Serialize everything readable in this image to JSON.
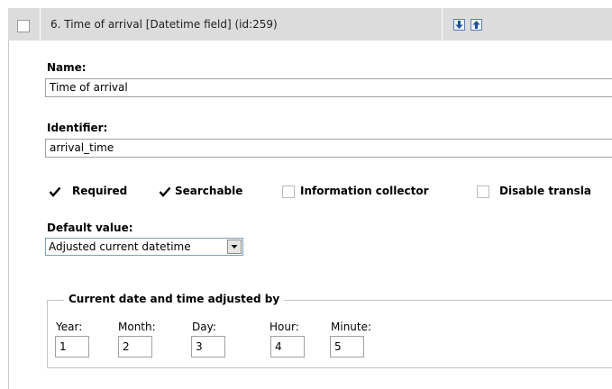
{
  "header": {
    "title": "6. Time of arrival [Datetime field] (id:259)",
    "move_down_icon": "arrow-down-icon",
    "move_up_icon": "arrow-up-icon"
  },
  "name": {
    "label": "Name:",
    "value": "Time of arrival"
  },
  "identifier": {
    "label": "Identifier:",
    "value": "arrival_time"
  },
  "options": [
    {
      "label": "Required",
      "checked": true
    },
    {
      "label": "Searchable",
      "checked": true
    },
    {
      "label": "Information collector",
      "checked": false
    },
    {
      "label": "Disable transla",
      "checked": false
    }
  ],
  "default_value": {
    "label": "Default value:",
    "selected": "Adjusted current datetime"
  },
  "adjust": {
    "legend": "Current date and time adjusted by",
    "fields": [
      {
        "label": "Year:",
        "value": "1"
      },
      {
        "label": "Month:",
        "value": "2"
      },
      {
        "label": "Day:",
        "value": "3"
      },
      {
        "label": "Hour:",
        "value": "4"
      },
      {
        "label": "Minute:",
        "value": "5"
      }
    ]
  },
  "colors": {
    "header_bg": "#dcdcdc",
    "border": "#a0a0a0",
    "arrow_blue": "#1f4f9e"
  }
}
